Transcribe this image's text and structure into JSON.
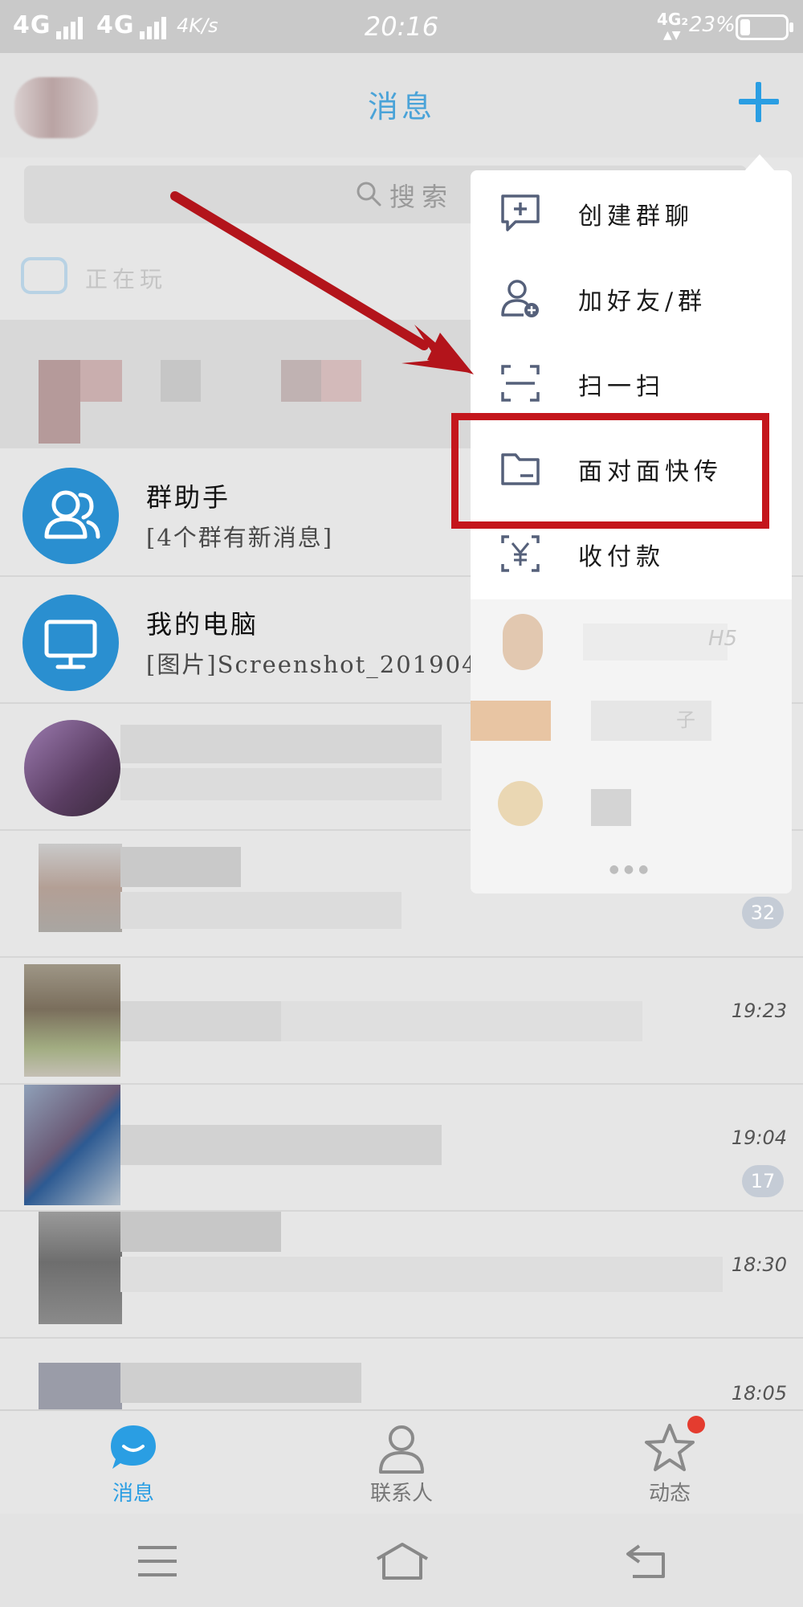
{
  "status_bar": {
    "signal_1": "4G",
    "signal_2": "4G",
    "net_speed": "4K/s",
    "time": "20:16",
    "network_type": "4G₂",
    "battery": "23%",
    "battery_level": 0.23
  },
  "header": {
    "title": "消息"
  },
  "search": {
    "placeholder": "搜索"
  },
  "playing": {
    "label": "正在玩"
  },
  "conversations": [
    {
      "name": "群助手",
      "message": "[4个群有新消息]",
      "time": "",
      "badge": ""
    },
    {
      "name": "我的电脑",
      "message": "[图片]Screenshot_2019042",
      "time": "",
      "badge": ""
    },
    {
      "name": "",
      "message": "",
      "time": "",
      "badge": ""
    },
    {
      "name": "",
      "message": "",
      "time": "",
      "badge": "32"
    },
    {
      "name": "",
      "message": "",
      "time": "19:23",
      "badge": ""
    },
    {
      "name": "",
      "message": "",
      "time": "19:04",
      "badge": "17"
    },
    {
      "name": "",
      "message": "",
      "time": "18:30",
      "badge": ""
    },
    {
      "name": "",
      "message": "",
      "time": "18:05",
      "badge": ""
    }
  ],
  "popup_menu": {
    "items": [
      {
        "label": "创建群聊",
        "icon": "create-group-chat-icon"
      },
      {
        "label": "加好友/群",
        "icon": "add-friend-icon"
      },
      {
        "label": "扫一扫",
        "icon": "scan-icon"
      },
      {
        "label": "面对面快传",
        "icon": "folder-transfer-icon"
      },
      {
        "label": "收付款",
        "icon": "payment-yuan-icon"
      }
    ],
    "more_label": "H5",
    "more_suffix": "子"
  },
  "tabs": [
    {
      "label": "消息",
      "icon": "message-bubble-icon",
      "active": true
    },
    {
      "label": "联系人",
      "icon": "contacts-person-icon",
      "active": false
    },
    {
      "label": "动态",
      "icon": "star-icon",
      "active": false
    }
  ],
  "colors": {
    "accent": "#2a9ee3",
    "highlight_box": "#c4161c",
    "notification_dot": "#e43c2f"
  }
}
